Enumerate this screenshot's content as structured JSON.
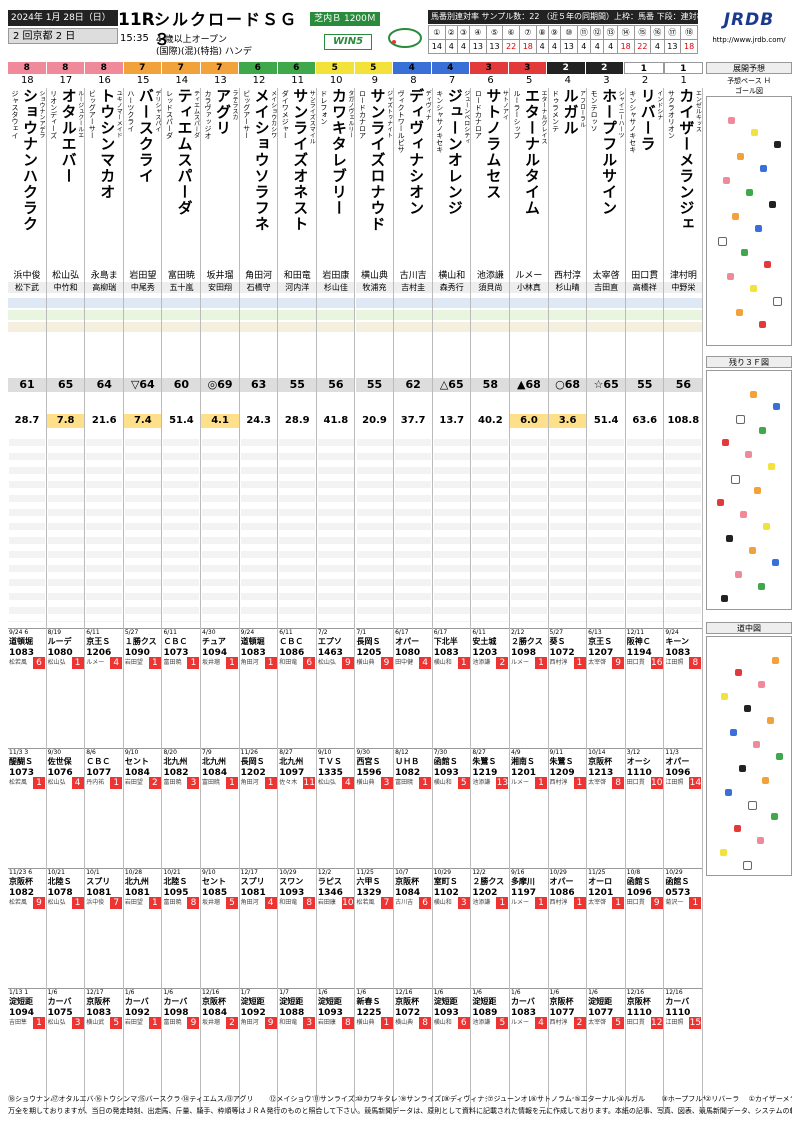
{
  "header": {
    "date": "2024年 1月 28日（日）",
    "race_no": "11R",
    "kaisai": "2 回京都 2 日",
    "post_time": "15:35",
    "race_name": "シルクロードＳＧ３",
    "course": "芝内Ｂ 1200Ｍ",
    "cond1": "4 歳以上オープン",
    "cond2": "(国際)(混)(特指) ハンデ",
    "win5": "WIN5",
    "stat_title": "馬番別連対率 サンプル数：22 （近５年の同期間）上枠：馬番 下段：連対率",
    "stat_numbers": [
      "①",
      "②",
      "③",
      "④",
      "⑤",
      "⑥",
      "⑦",
      "⑧",
      "⑨",
      "⑩",
      "⑪",
      "⑫",
      "⑬",
      "⑭",
      "⑮",
      "⑯",
      "⑰",
      "⑱"
    ],
    "stat_rates": [
      "14",
      "4",
      "4",
      "13",
      "13",
      "22",
      "18",
      "4",
      "4",
      "13",
      "4",
      "4",
      "4",
      "18",
      "22",
      "4",
      "13",
      "18"
    ],
    "logo": "JRDB",
    "url": "http://www.jrdb.com/"
  },
  "frames": [
    {
      "label": "8",
      "color": "#f08a9a"
    },
    {
      "label": "8",
      "color": "#f08a9a"
    },
    {
      "label": "8",
      "color": "#f08a9a"
    },
    {
      "label": "7",
      "color": "#f2a23a"
    },
    {
      "label": "7",
      "color": "#f2a23a"
    },
    {
      "label": "7",
      "color": "#f2a23a"
    },
    {
      "label": "6",
      "color": "#3ea84a"
    },
    {
      "label": "6",
      "color": "#3ea84a"
    },
    {
      "label": "5",
      "color": "#f2e23a"
    },
    {
      "label": "5",
      "color": "#f2e23a"
    },
    {
      "label": "4",
      "color": "#3a6fd8"
    },
    {
      "label": "4",
      "color": "#3a6fd8"
    },
    {
      "label": "3",
      "color": "#e23a3a"
    },
    {
      "label": "3",
      "color": "#e23a3a"
    },
    {
      "label": "2",
      "color": "#222222"
    },
    {
      "label": "2",
      "color": "#222222"
    },
    {
      "label": "1",
      "color": "#ffffff"
    },
    {
      "label": "1",
      "color": "#ffffff"
    }
  ],
  "horses": [
    {
      "no": "18",
      "name": "ショウナンハクラク",
      "sire": "ジャスタウェイ",
      "dam": "ショウナンアデラ",
      "jockey": "浜中俊",
      "trainer": "松下武",
      "index": "61",
      "odds": "28.7",
      "past": [
        {
          "date": "9/24 6",
          "race": "道頓堀",
          "time": "1083",
          "place": "松若風",
          "fin": "6"
        },
        {
          "date": "11/3 3",
          "race": "醍醐Ｓ",
          "time": "1073",
          "place": "松若風",
          "fin": "1"
        },
        {
          "date": "11/23 6",
          "race": "京阪杯",
          "time": "1082",
          "place": "松若風",
          "fin": "9"
        },
        {
          "date": "1/13 1",
          "race": "淀短距",
          "time": "1094",
          "place": "吉田隼",
          "fin": "1"
        }
      ]
    },
    {
      "no": "17",
      "name": "オタルエバー",
      "sire": "リオンディーズ",
      "dam": "ルージュクールエ",
      "jockey": "松山弘",
      "trainer": "中竹和",
      "index": "65",
      "odds": "7.8",
      "past": [
        {
          "date": "8/19",
          "race": "ルーデ",
          "time": "1080",
          "place": "松山弘",
          "fin": "1"
        },
        {
          "date": "9/30",
          "race": "佐世保",
          "time": "1076",
          "place": "松山弘",
          "fin": "4"
        },
        {
          "date": "10/21",
          "race": "北陸Ｓ",
          "time": "1078",
          "place": "松山弘",
          "fin": "1"
        },
        {
          "date": "1/6",
          "race": "カーバ",
          "time": "1075",
          "place": "松山弘",
          "fin": "3"
        }
      ]
    },
    {
      "no": "16",
      "name": "トウシンマカオ",
      "sire": "ビッグアーサー",
      "dam": "ユキノマーメイド",
      "jockey": "永島ま",
      "trainer": "高柳瑞",
      "index": "64",
      "odds": "21.6",
      "past": [
        {
          "date": "6/11",
          "race": "京王Ｓ",
          "time": "1206",
          "place": "ルメー",
          "fin": "4"
        },
        {
          "date": "8/6",
          "race": "ＣＢＣ",
          "time": "1077",
          "place": "丹内祐",
          "fin": "1"
        },
        {
          "date": "10/1",
          "race": "スプリ",
          "time": "1081",
          "place": "浜中俊",
          "fin": "7"
        },
        {
          "date": "12/17",
          "race": "京阪杯",
          "time": "1083",
          "place": "横山武",
          "fin": "5"
        }
      ]
    },
    {
      "no": "15",
      "name": "バースクライ",
      "sire": "ハーツクライ",
      "dam": "デリシャスパイ",
      "jockey": "岩田望",
      "trainer": "中尾秀",
      "index": "▽64",
      "odds": "7.4",
      "past": [
        {
          "date": "5/27",
          "race": "１勝クス",
          "time": "1090",
          "place": "岩田望",
          "fin": "1"
        },
        {
          "date": "9/10",
          "race": "セント",
          "time": "1084",
          "place": "岩田望",
          "fin": "2"
        },
        {
          "date": "10/28",
          "race": "北九州",
          "time": "1081",
          "place": "岩田望",
          "fin": "1"
        },
        {
          "date": "1/6",
          "race": "カーバ",
          "time": "1092",
          "place": "岩田望",
          "fin": "1"
        }
      ]
    },
    {
      "no": "14",
      "name": "ティエムスパーダ",
      "sire": "レッドスパーダ",
      "dam": "ティエムスパーダ",
      "jockey": "富田暁",
      "trainer": "五十嵐",
      "index": "60",
      "odds": "51.4",
      "past": [
        {
          "date": "6/11",
          "race": "ＣＢＣ",
          "time": "1073",
          "place": "富田暁",
          "fin": "1"
        },
        {
          "date": "8/20",
          "race": "北九州",
          "time": "1082",
          "place": "富田暁",
          "fin": "3"
        },
        {
          "date": "10/21",
          "race": "北陸Ｓ",
          "time": "1095",
          "place": "富田暁",
          "fin": "8"
        },
        {
          "date": "1/6",
          "race": "カーバ",
          "time": "1098",
          "place": "富田暁",
          "fin": "9"
        }
      ]
    },
    {
      "no": "13",
      "name": "アグリ",
      "sire": "カラヴァッジオ",
      "dam": "ラテラスカ",
      "jockey": "坂井瑠",
      "trainer": "安田翔",
      "index": "◎69",
      "odds": "4.1",
      "past": [
        {
          "date": "4/30",
          "race": "チュア",
          "time": "1094",
          "place": "坂井瑠",
          "fin": "1"
        },
        {
          "date": "7/9",
          "race": "北九州",
          "time": "1084",
          "place": "富田暁",
          "fin": "1"
        },
        {
          "date": "9/10",
          "race": "セント",
          "time": "1085",
          "place": "坂井瑠",
          "fin": "5"
        },
        {
          "date": "12/16",
          "race": "京阪杯",
          "time": "1084",
          "place": "坂井瑠",
          "fin": "2"
        }
      ]
    },
    {
      "no": "12",
      "name": "メイショウソラフネ",
      "sire": "ビッグアーサー",
      "dam": "メイショウカシワ",
      "jockey": "角田河",
      "trainer": "石橋守",
      "index": "63",
      "odds": "24.3",
      "past": [
        {
          "date": "9/24",
          "race": "道頓堀",
          "time": "1083",
          "place": "角田河",
          "fin": "1"
        },
        {
          "date": "11/26",
          "race": "長岡Ｓ",
          "time": "1202",
          "place": "角田河",
          "fin": "1"
        },
        {
          "date": "12/17",
          "race": "スプリ",
          "time": "1081",
          "place": "角田河",
          "fin": "4"
        },
        {
          "date": "1/7",
          "race": "淀短距",
          "time": "1092",
          "place": "角田河",
          "fin": "9"
        }
      ]
    },
    {
      "no": "11",
      "name": "サンライズオネスト",
      "sire": "ダイワメジャー",
      "dam": "サンライズスマイル",
      "jockey": "和田竜",
      "trainer": "河内洋",
      "index": "55",
      "odds": "28.9",
      "past": [
        {
          "date": "6/11",
          "race": "ＣＢＣ",
          "time": "1086",
          "place": "和田竜",
          "fin": "6"
        },
        {
          "date": "8/27",
          "race": "北九州",
          "time": "1097",
          "place": "佐々木",
          "fin": "11"
        },
        {
          "date": "10/29",
          "race": "スワン",
          "time": "1093",
          "place": "和田竜",
          "fin": "8"
        },
        {
          "date": "1/7",
          "race": "淀短距",
          "time": "1088",
          "place": "和田竜",
          "fin": "3"
        }
      ]
    },
    {
      "no": "10",
      "name": "カワキタレブリー",
      "sire": "ドレフォン",
      "dam": "タガノヴェルリー",
      "jockey": "岩田康",
      "trainer": "杉山佳",
      "index": "56",
      "odds": "41.8",
      "past": [
        {
          "date": "7/2",
          "race": "エプソ",
          "time": "1463",
          "place": "松山弘",
          "fin": "9"
        },
        {
          "date": "9/10",
          "race": "ＴＶＳ",
          "time": "1335",
          "place": "松山弘",
          "fin": "4"
        },
        {
          "date": "12/2",
          "race": "ラピス",
          "time": "1346",
          "place": "岩田康",
          "fin": "10"
        },
        {
          "date": "1/6",
          "race": "淀短距",
          "time": "1093",
          "place": "岩田康",
          "fin": "8"
        }
      ]
    },
    {
      "no": "9",
      "name": "サンライズロナウド",
      "sire": "ロードカナロア",
      "dam": "ジャズトゥナイト",
      "jockey": "横山典",
      "trainer": "牧浦充",
      "index": "55",
      "odds": "20.9",
      "past": [
        {
          "date": "7/1",
          "race": "長岡Ｓ",
          "time": "1205",
          "place": "横山典",
          "fin": "9"
        },
        {
          "date": "9/30",
          "race": "西宮Ｓ",
          "time": "1596",
          "place": "横山典",
          "fin": "3"
        },
        {
          "date": "11/25",
          "race": "六甲Ｓ",
          "time": "1329",
          "place": "松若風",
          "fin": "7"
        },
        {
          "date": "1/6",
          "race": "新春Ｓ",
          "time": "1225",
          "place": "横山典",
          "fin": "1"
        }
      ]
    },
    {
      "no": "8",
      "name": "ディヴィナシオン",
      "sire": "ヴィクトワールピサ",
      "dam": "ディヴィナ",
      "jockey": "古川吉",
      "trainer": "吉村圭",
      "index": "62",
      "odds": "37.7",
      "past": [
        {
          "date": "6/17",
          "race": "オパー",
          "time": "1080",
          "place": "田中健",
          "fin": "4"
        },
        {
          "date": "8/12",
          "race": "ＵＨＢ",
          "time": "1082",
          "place": "富田暁",
          "fin": "1"
        },
        {
          "date": "10/7",
          "race": "京阪杯",
          "time": "1084",
          "place": "古川吉",
          "fin": "6"
        },
        {
          "date": "12/16",
          "race": "京阪杯",
          "time": "1072",
          "place": "横山典",
          "fin": "8"
        }
      ]
    },
    {
      "no": "7",
      "name": "ジューンオレンジ",
      "sire": "キンシャサノキセキ",
      "dam": "ジューンベロシティ",
      "jockey": "横山和",
      "trainer": "森秀行",
      "index": "△65",
      "odds": "13.7",
      "past": [
        {
          "date": "6/17",
          "race": "下北半",
          "time": "1083",
          "place": "横山和",
          "fin": "1"
        },
        {
          "date": "7/30",
          "race": "函館Ｓ",
          "time": "1093",
          "place": "横山和",
          "fin": "5"
        },
        {
          "date": "10/29",
          "race": "室町Ｓ",
          "time": "1102",
          "place": "横山和",
          "fin": "3"
        },
        {
          "date": "1/6",
          "race": "淀短距",
          "time": "1093",
          "place": "横山和",
          "fin": "6"
        }
      ]
    },
    {
      "no": "6",
      "name": "サトノラムセス",
      "sire": "ロードカナロア",
      "dam": "サトノアイ",
      "jockey": "池添謙",
      "trainer": "須貝尚",
      "index": "58",
      "odds": "40.2",
      "past": [
        {
          "date": "6/11",
          "race": "安土城",
          "time": "1203",
          "place": "池添謙",
          "fin": "2"
        },
        {
          "date": "8/27",
          "race": "朱鷺Ｓ",
          "time": "1219",
          "place": "池添謙",
          "fin": "13"
        },
        {
          "date": "12/2",
          "race": "２勝クス",
          "time": "1202",
          "place": "池添謙",
          "fin": "1"
        },
        {
          "date": "1/6",
          "race": "淀短距",
          "time": "1089",
          "place": "池添謙",
          "fin": "5"
        }
      ]
    },
    {
      "no": "5",
      "name": "エターナルタイム",
      "sire": "ルーラーシップ",
      "dam": "エターナルグレイス",
      "jockey": "ルメー",
      "trainer": "小林真",
      "index": "▲68",
      "odds": "6.0",
      "past": [
        {
          "date": "2/12",
          "race": "２勝クス",
          "time": "1098",
          "place": "ルメー",
          "fin": "1"
        },
        {
          "date": "4/9",
          "race": "湘南Ｓ",
          "time": "1201",
          "place": "ルメー",
          "fin": "1"
        },
        {
          "date": "9/16",
          "race": "多摩川",
          "time": "1197",
          "place": "ルメー",
          "fin": "1"
        },
        {
          "date": "1/6",
          "race": "カーバ",
          "time": "1083",
          "place": "ルメー",
          "fin": "4"
        }
      ]
    },
    {
      "no": "4",
      "name": "ルガル",
      "sire": "ドゥラメンテ",
      "dam": "ア フローラル",
      "jockey": "西村淳",
      "trainer": "杉山晴",
      "index": "○68",
      "odds": "3.6",
      "past": [
        {
          "date": "5/27",
          "race": "葵Ｓ",
          "time": "1072",
          "place": "西村淳",
          "fin": "1"
        },
        {
          "date": "9/11",
          "race": "朱鷺Ｓ",
          "time": "1209",
          "place": "西村淳",
          "fin": "1"
        },
        {
          "date": "10/29",
          "race": "オパー",
          "time": "1086",
          "place": "西村淳",
          "fin": "1"
        },
        {
          "date": "1/6",
          "race": "京阪杯",
          "time": "1077",
          "place": "西村淳",
          "fin": "2"
        }
      ]
    },
    {
      "no": "3",
      "name": "ホープフルサイン",
      "sire": "モンテロッソ",
      "dam": "シャイニーハーツ",
      "jockey": "太宰啓",
      "trainer": "吉田直",
      "index": "☆65",
      "odds": "51.4",
      "past": [
        {
          "date": "6/13",
          "race": "京王Ｓ",
          "time": "1207",
          "place": "太宰啓",
          "fin": "9"
        },
        {
          "date": "10/14",
          "race": "京阪杯",
          "time": "1213",
          "place": "太宰啓",
          "fin": "8"
        },
        {
          "date": "11/25",
          "race": "オーロ",
          "time": "1201",
          "place": "太宰啓",
          "fin": "1"
        },
        {
          "date": "1/6",
          "race": "淀短距",
          "time": "1077",
          "place": "太宰啓",
          "fin": "5"
        }
      ]
    },
    {
      "no": "2",
      "name": "リバーラ",
      "sire": "キンシャサノキセキ",
      "dam": "インドシナ",
      "jockey": "田口貫",
      "trainer": "高橋祥",
      "index": "55",
      "odds": "63.6",
      "past": [
        {
          "date": "12/11",
          "race": "阪神Ｃ",
          "time": "1194",
          "place": "田口貫",
          "fin": "16"
        },
        {
          "date": "3/12",
          "race": "オーシ",
          "time": "1110",
          "place": "田口貫",
          "fin": "10"
        },
        {
          "date": "10/8",
          "race": "函館Ｓ",
          "time": "1096",
          "place": "田口貫",
          "fin": "9"
        },
        {
          "date": "12/16",
          "race": "京阪杯",
          "time": "1110",
          "place": "田口貫",
          "fin": "12"
        }
      ]
    },
    {
      "no": "1",
      "name": "カイザーメランジェ",
      "sire": "サクラオリオン",
      "dam": "エンゼルキッス",
      "jockey": "津村明",
      "trainer": "中野栄",
      "index": "56",
      "odds": "108.8",
      "past": [
        {
          "date": "9/24",
          "race": "キーン",
          "time": "1083",
          "place": "江田照",
          "fin": "8"
        },
        {
          "date": "11/3",
          "race": "オパー",
          "time": "1096",
          "place": "江田照",
          "fin": "14"
        },
        {
          "date": "10/29",
          "race": "函館Ｓ",
          "time": "0573",
          "place": "菊沢一",
          "fin": "1"
        },
        {
          "date": "12/16",
          "race": "カーバ",
          "time": "1110",
          "place": "江田照",
          "fin": "15"
        }
      ]
    }
  ],
  "side": {
    "tenkai_title": "展開予想",
    "pace_label": "予想ペース Ｈ",
    "goal_label": "ゴール図",
    "san_f_label": "残り３Ｆ図",
    "dochu_label": "道中図",
    "sotonaka": "外 中 内"
  },
  "footer": {
    "horses": [
      "⑱ショウナンハ",
      "⑰オタルエバー",
      "⑯トウシンマカ",
      "⑮バースクライ",
      "⑭ティエムスパ",
      "⑬アグリ",
      "⑫メイショウソ",
      "⑪サンライズオ",
      "⑩カワキタレブ",
      "⑨サンライズロ",
      "⑧ディヴィナシ",
      "⑦ジューンオレ",
      "⑥サトノラムセ",
      "⑤エターナルタ",
      "④ルガル",
      "③ホープフルサ",
      "②リバーラ",
      "①カイザーメラ"
    ],
    "note": "万全を期しておりますが、当日の発走時刻、出走馬、斤量、騎手、枠順等はＪＲＡ発行のものと照合して下さい。競馬新聞データは、原則として資料に記載された情報を元に作成しております。本紙の記事、写真、図表、競馬新聞データ、システムの転載を禁じます。"
  }
}
